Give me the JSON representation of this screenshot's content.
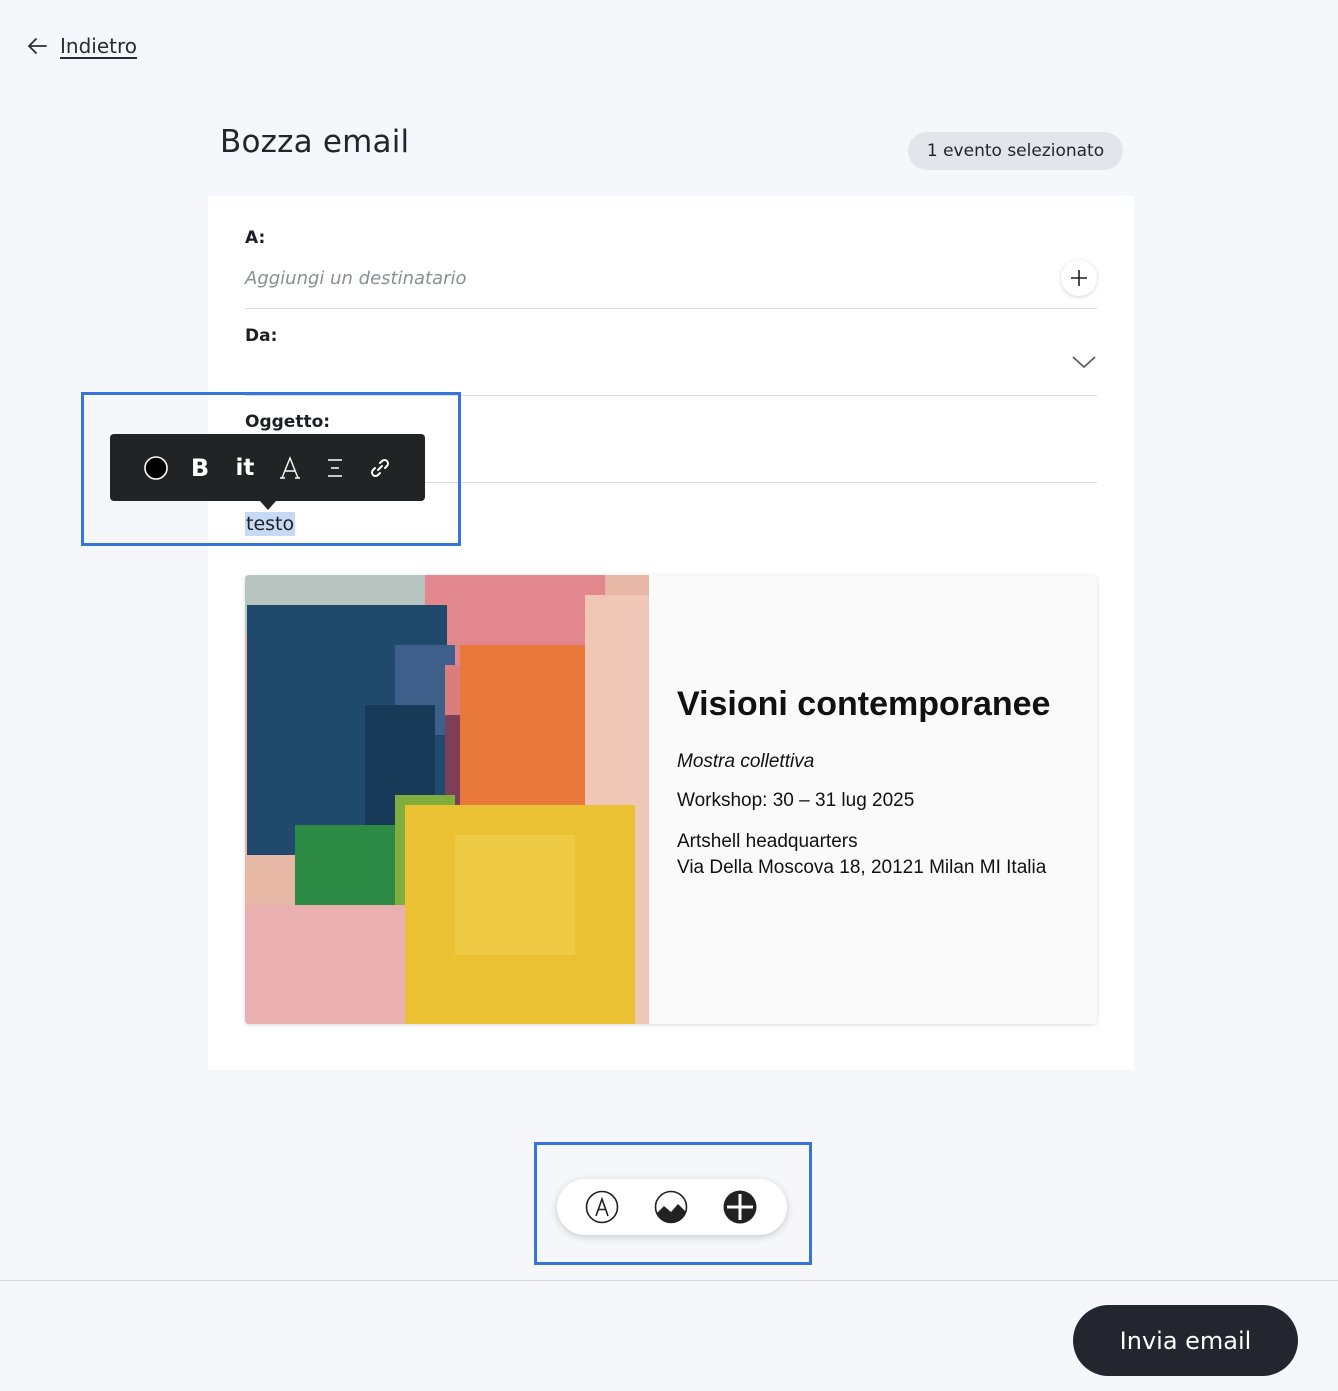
{
  "nav": {
    "back_label": "Indietro"
  },
  "header": {
    "title": "Bozza email",
    "badge": "1 evento selezionato"
  },
  "form": {
    "to_label": "A:",
    "to_placeholder": "Aggiungi un destinatario",
    "from_label": "Da:",
    "from_value": "",
    "subject_label": "Oggetto:",
    "subject_value": ""
  },
  "body": {
    "text": "testo"
  },
  "event": {
    "title": "Visioni contemporanee",
    "type": "Mostra collettiva",
    "dates": "Workshop: 30 – 31 lug 2025",
    "venue": "Artshell headquarters",
    "address": "Via Della Moscova 18, 20121 Milan MI Italia"
  },
  "format_toolbar": {
    "icons": [
      "color-circle-icon",
      "bold-icon",
      "italic-icon",
      "font-icon",
      "align-icon",
      "link-icon"
    ],
    "bold_glyph": "B",
    "italic_glyph": "it"
  },
  "block_toolbar": {
    "icons": [
      "text-block-icon",
      "image-block-icon",
      "add-block-icon"
    ]
  },
  "footer": {
    "send_label": "Invia email"
  },
  "colors": {
    "highlight": "#3774da",
    "selection": "#c6daf5",
    "dark": "#23262f"
  }
}
